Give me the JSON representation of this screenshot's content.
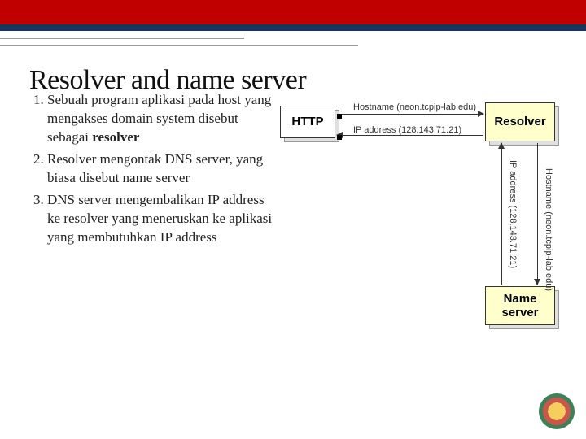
{
  "header": {
    "title": "Resolver and name server"
  },
  "points": {
    "p1_pre": "Sebuah program aplikasi pada host yang mengakses domain system disebut sebagai ",
    "p1_kw": "resolver",
    "p2": "Resolver mengontak DNS server, yang biasa disebut name server",
    "p3": "DNS server mengembalikan IP address ke resolver yang meneruskan ke aplikasi yang membutuhkan IP address"
  },
  "diagram": {
    "http": "HTTP",
    "resolver": "Resolver",
    "name_server": "Name server",
    "label_hostname_h": "Hostname (neon.tcpip-lab.edu)",
    "label_ip_h": "IP address (128.143.71.21)",
    "label_ip_v": "IP address (128.143.71.21)",
    "label_hostname_v": "Hostname (neon.tcpip-lab.edu)"
  }
}
